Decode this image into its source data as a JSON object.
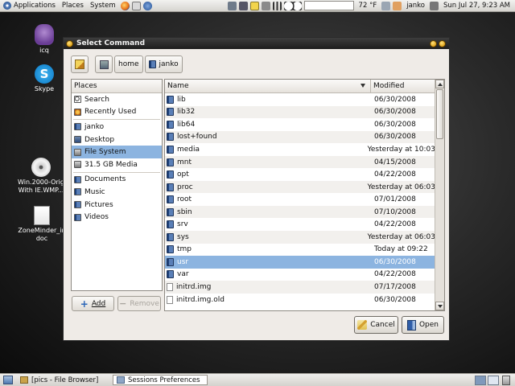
{
  "top_panel": {
    "menus": [
      "Applications",
      "Places",
      "System"
    ],
    "temperature": "72 °F",
    "user": "janko",
    "clock": "Sun Jul 27,  9:23 AM"
  },
  "desktop_icons": [
    {
      "label": "icq",
      "icon": "icq-flower-icon"
    },
    {
      "label": "Skype",
      "icon": "skype-icon"
    },
    {
      "label": "Win.2000-Orig With IE.WMP...",
      "icon": "cd-icon"
    },
    {
      "label": "ZoneMinder_in doc",
      "icon": "document-icon"
    }
  ],
  "dialog": {
    "title": "Select Command",
    "path_buttons": [
      "home",
      "janko"
    ],
    "places_header": "Places",
    "places": [
      {
        "label": "Search",
        "icon": "search-icon"
      },
      {
        "label": "Recently Used",
        "icon": "recent-icon"
      },
      {
        "sep": true
      },
      {
        "label": "janko",
        "icon": "home-folder-icon"
      },
      {
        "label": "Desktop",
        "icon": "desktop-icon"
      },
      {
        "label": "File System",
        "icon": "drive-icon",
        "selected": true
      },
      {
        "label": "31.5 GB Media",
        "icon": "drive-icon"
      },
      {
        "sep": true
      },
      {
        "label": "Documents",
        "icon": "folder-icon"
      },
      {
        "label": "Music",
        "icon": "folder-icon"
      },
      {
        "label": "Pictures",
        "icon": "folder-icon"
      },
      {
        "label": "Videos",
        "icon": "folder-icon"
      }
    ],
    "column_name": "Name",
    "column_modified": "Modified",
    "files": [
      {
        "name": "lib",
        "modified": "06/30/2008",
        "type": "folder"
      },
      {
        "name": "lib32",
        "modified": "06/30/2008",
        "type": "folder"
      },
      {
        "name": "lib64",
        "modified": "06/30/2008",
        "type": "folder"
      },
      {
        "name": "lost+found",
        "modified": "06/30/2008",
        "type": "folder"
      },
      {
        "name": "media",
        "modified": "Yesterday at 10:03",
        "type": "folder"
      },
      {
        "name": "mnt",
        "modified": "04/15/2008",
        "type": "folder"
      },
      {
        "name": "opt",
        "modified": "04/22/2008",
        "type": "folder"
      },
      {
        "name": "proc",
        "modified": "Yesterday at 06:03",
        "type": "folder"
      },
      {
        "name": "root",
        "modified": "07/01/2008",
        "type": "folder"
      },
      {
        "name": "sbin",
        "modified": "07/10/2008",
        "type": "folder"
      },
      {
        "name": "srv",
        "modified": "04/22/2008",
        "type": "folder"
      },
      {
        "name": "sys",
        "modified": "Yesterday at 06:03",
        "type": "folder"
      },
      {
        "name": "tmp",
        "modified": "Today at 09:22",
        "type": "folder"
      },
      {
        "name": "usr",
        "modified": "06/30/2008",
        "type": "folder",
        "selected": true
      },
      {
        "name": "var",
        "modified": "04/22/2008",
        "type": "folder"
      },
      {
        "name": "initrd.img",
        "modified": "07/17/2008",
        "type": "file"
      },
      {
        "name": "initrd.img.old",
        "modified": "06/30/2008",
        "type": "file"
      }
    ],
    "add_label": "Add",
    "remove_label": "Remove",
    "cancel_label": "Cancel",
    "open_label": "Open"
  },
  "bottom_panel": {
    "tasks": [
      {
        "label": "[pics - File Browser]",
        "active": false
      },
      {
        "label": "Sessions Preferences",
        "active": true
      }
    ]
  },
  "colors": {
    "selection": "#8cb4e0",
    "titlebar": "#1d1d1d",
    "dialog_bg": "#efebe7"
  }
}
